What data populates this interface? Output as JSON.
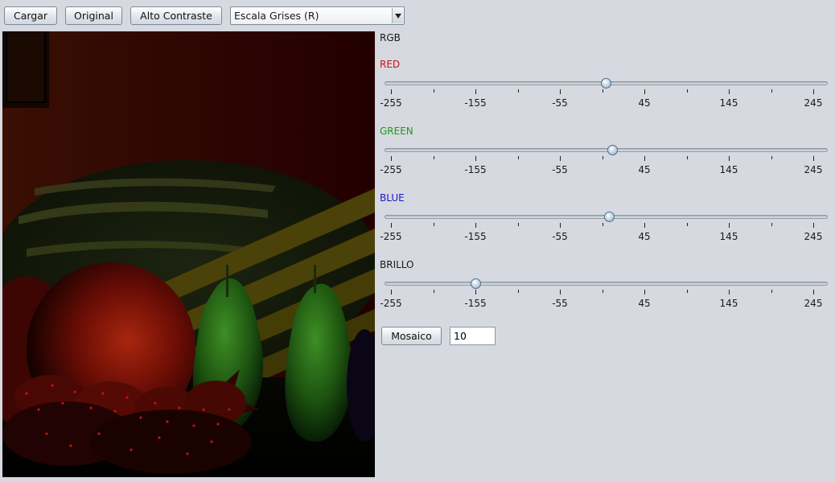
{
  "toolbar": {
    "load_label": "Cargar",
    "original_label": "Original",
    "contrast_label": "Alto Contraste",
    "filter_select": "Escala Grises (R)"
  },
  "controls": {
    "rgb_label": "RGB",
    "tick_labels": [
      "-255",
      "-155",
      "-55",
      "45",
      "145",
      "245"
    ],
    "sliders": [
      {
        "key": "red",
        "label": "RED",
        "color": "#c81414",
        "value": 0
      },
      {
        "key": "green",
        "label": "GREEN",
        "color": "#1a9a1a",
        "value": 7
      },
      {
        "key": "blue",
        "label": "BLUE",
        "color": "#1a1ac8",
        "value": 4
      },
      {
        "key": "brightness",
        "label": "BRILLO",
        "color": "#1a1a1a",
        "value": -155
      }
    ],
    "slider_min": -255,
    "slider_max": 245,
    "mosaic_label": "Mosaico",
    "mosaic_value": "10"
  }
}
